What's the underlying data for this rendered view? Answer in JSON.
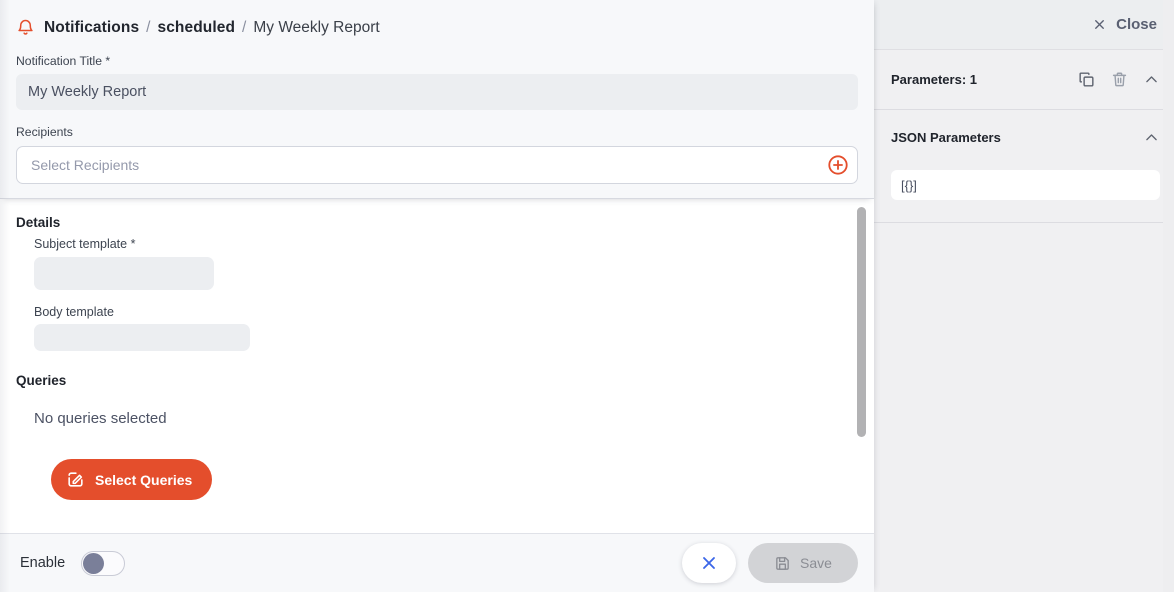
{
  "breadcrumb": {
    "icon": "bell-icon",
    "root": "Notifications",
    "separator": "/",
    "middle": "scheduled",
    "current": "My Weekly Report"
  },
  "form": {
    "title_label": "Notification Title *",
    "title_value": "My Weekly Report",
    "recipients_label": "Recipients",
    "recipients_value": "",
    "recipients_placeholder": "Select Recipients",
    "add_recipient_icon": "plus-circle-icon"
  },
  "details": {
    "heading": "Details",
    "subject_label": "Subject template *",
    "subject_value": "",
    "body_label": "Body template",
    "body_value": ""
  },
  "queries": {
    "heading": "Queries",
    "empty_text": "No queries selected",
    "button_label": "Select Queries",
    "button_icon": "edit-square-icon",
    "button_color": "#e44e2c"
  },
  "bottom_bar": {
    "enable_label": "Enable",
    "enable_on": false,
    "close_icon": "close-x-icon",
    "close_icon_color": "#3b66e8",
    "save_label": "Save",
    "save_icon": "floppy-disk-icon",
    "save_disabled": true
  },
  "right_panel": {
    "close_label": "Close",
    "close_icon": "close-x-icon",
    "parameters_label": "Parameters: 1",
    "copy_icon": "copy-icon",
    "delete_icon": "trash-icon",
    "collapse_icon": "chevron-up-icon",
    "json_heading": "JSON Parameters",
    "json_collapse_icon": "chevron-up-icon",
    "json_value": "[{}]"
  }
}
